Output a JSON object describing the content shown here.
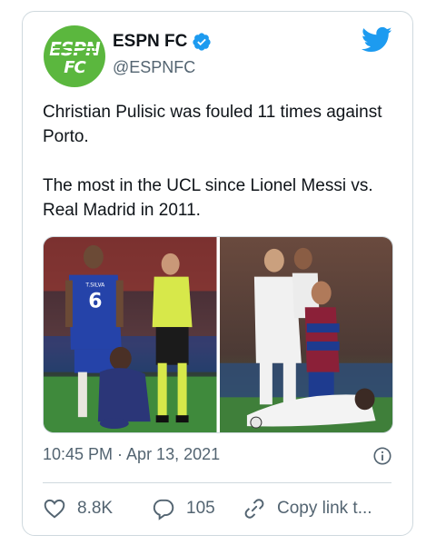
{
  "account": {
    "name": "ESPN FC",
    "handle": "@ESPNFC",
    "avatar_line1": "ESPN",
    "avatar_line2": "FC",
    "avatar_color": "#5bb73e"
  },
  "tweet": {
    "paragraphs": [
      "Christian Pulisic was fouled 11 times against Porto.",
      "The most in the UCL since Lionel Messi vs. Real Madrid in 2011."
    ],
    "timestamp": "10:45 PM · Apr 13, 2021"
  },
  "media": {
    "left_photo": {
      "jersey_name": "T.SILVA",
      "jersey_number": "6"
    },
    "right_photo": {}
  },
  "actions": {
    "likes": "8.8K",
    "replies": "105",
    "copy_link": "Copy link t..."
  },
  "icons": {
    "verified": "verified-badge-icon",
    "bird": "twitter-bird-icon",
    "info": "info-icon",
    "heart": "heart-icon",
    "reply": "reply-bubble-icon",
    "link": "link-icon"
  },
  "colors": {
    "twitter_blue": "#1d9bf0",
    "text": "#0f1419",
    "secondary": "#536471",
    "border": "#cfd9de"
  }
}
